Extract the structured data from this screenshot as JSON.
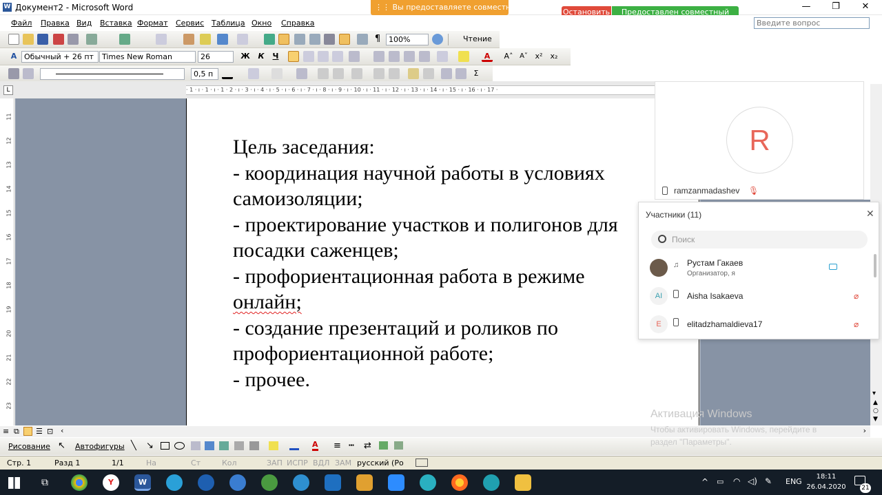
{
  "window": {
    "title": "Документ2 - Microsoft Word",
    "share_banner": "⋮⋮ Вы предоставляете совместный д...",
    "stop_label": "Остановить",
    "shared_status": "Предоставлен совместный доступ",
    "ask_placeholder": "Введите вопрос",
    "minimize": "—",
    "restore": "❐",
    "close": "✕"
  },
  "menu": [
    "Файл",
    "Правка",
    "Вид",
    "Вставка",
    "Формат",
    "Сервис",
    "Таблица",
    "Окно",
    "Справка"
  ],
  "standard_toolbar": {
    "zoom": "100%",
    "reading_label": "Чтение"
  },
  "formatting_toolbar": {
    "style": "Обычный + 26 пт",
    "font": "Times New Roman",
    "size": "26",
    "bold": "Ж",
    "italic": "К",
    "underline": "Ч"
  },
  "drawing_line_toolbar": {
    "line_width": "0,5 п"
  },
  "ruler": {
    "marks": "· 1 · ı · 1 · ı · 1 · 2 · ı · 3 · ı · 4 · ı · 5 · ı · 6 · ı · 7 · ı · 8 · ı · 9 · ı · 10 · ı · 11 · ı · 12 · ı · 13 · ı · 14 · ı · 15 · ı · 16 · ı · 17 ·"
  },
  "vruler_numbers": [
    "11",
    "12",
    "13",
    "14",
    "15",
    "16",
    "17",
    "18",
    "19",
    "20",
    "21",
    "22",
    "23"
  ],
  "document": {
    "lines": [
      "Цель заседания:",
      "- координация научной работы в условиях",
      "самоизоляции;",
      "- проектирование участков и полигонов для",
      "посадки саженцев;",
      "- профориентационная работа в режиме",
      "онлайн;",
      "- создание презентаций и роликов по",
      "профориентационной работе;",
      "- прочее."
    ]
  },
  "drawing_toolbar": {
    "drawing": "Рисование",
    "autoshapes": "Автофигуры"
  },
  "statusbar": {
    "page": "Стр. 1",
    "section": "Разд 1",
    "pages": "1/1",
    "at": "На",
    "line": "Ст",
    "col": "Кол",
    "rec": "ЗАП",
    "trk": "ИСПР",
    "ext": "ВДЛ",
    "ovr": "ЗАМ",
    "language": "русский (Ро"
  },
  "video": {
    "avatar_letter": "R",
    "name": "ramzanmadashev"
  },
  "participants": {
    "title": "Участники (11)",
    "search_placeholder": "Поиск",
    "items": [
      {
        "name": "Рустам Гакаев",
        "role": "Организатор, я",
        "avatar": ""
      },
      {
        "name": "Aisha Isakaeva",
        "avatar": "AI"
      },
      {
        "name": "elitadzhamaldieva17",
        "avatar": "E"
      }
    ]
  },
  "watermark": {
    "title": "Активация Windows",
    "text1": "Чтобы активировать Windows, перейдите в",
    "text2": "раздел \"Параметры\"."
  },
  "taskbar": {
    "language": "ENG",
    "time": "18:11",
    "date": "26.04.2020",
    "notifications": "21"
  },
  "colors": {
    "accent_orange": "#f0a030",
    "stop_red": "#e04a3a",
    "share_green": "#3cb043",
    "doc_bg": "#8793a5",
    "taskbar": "#141d27"
  }
}
